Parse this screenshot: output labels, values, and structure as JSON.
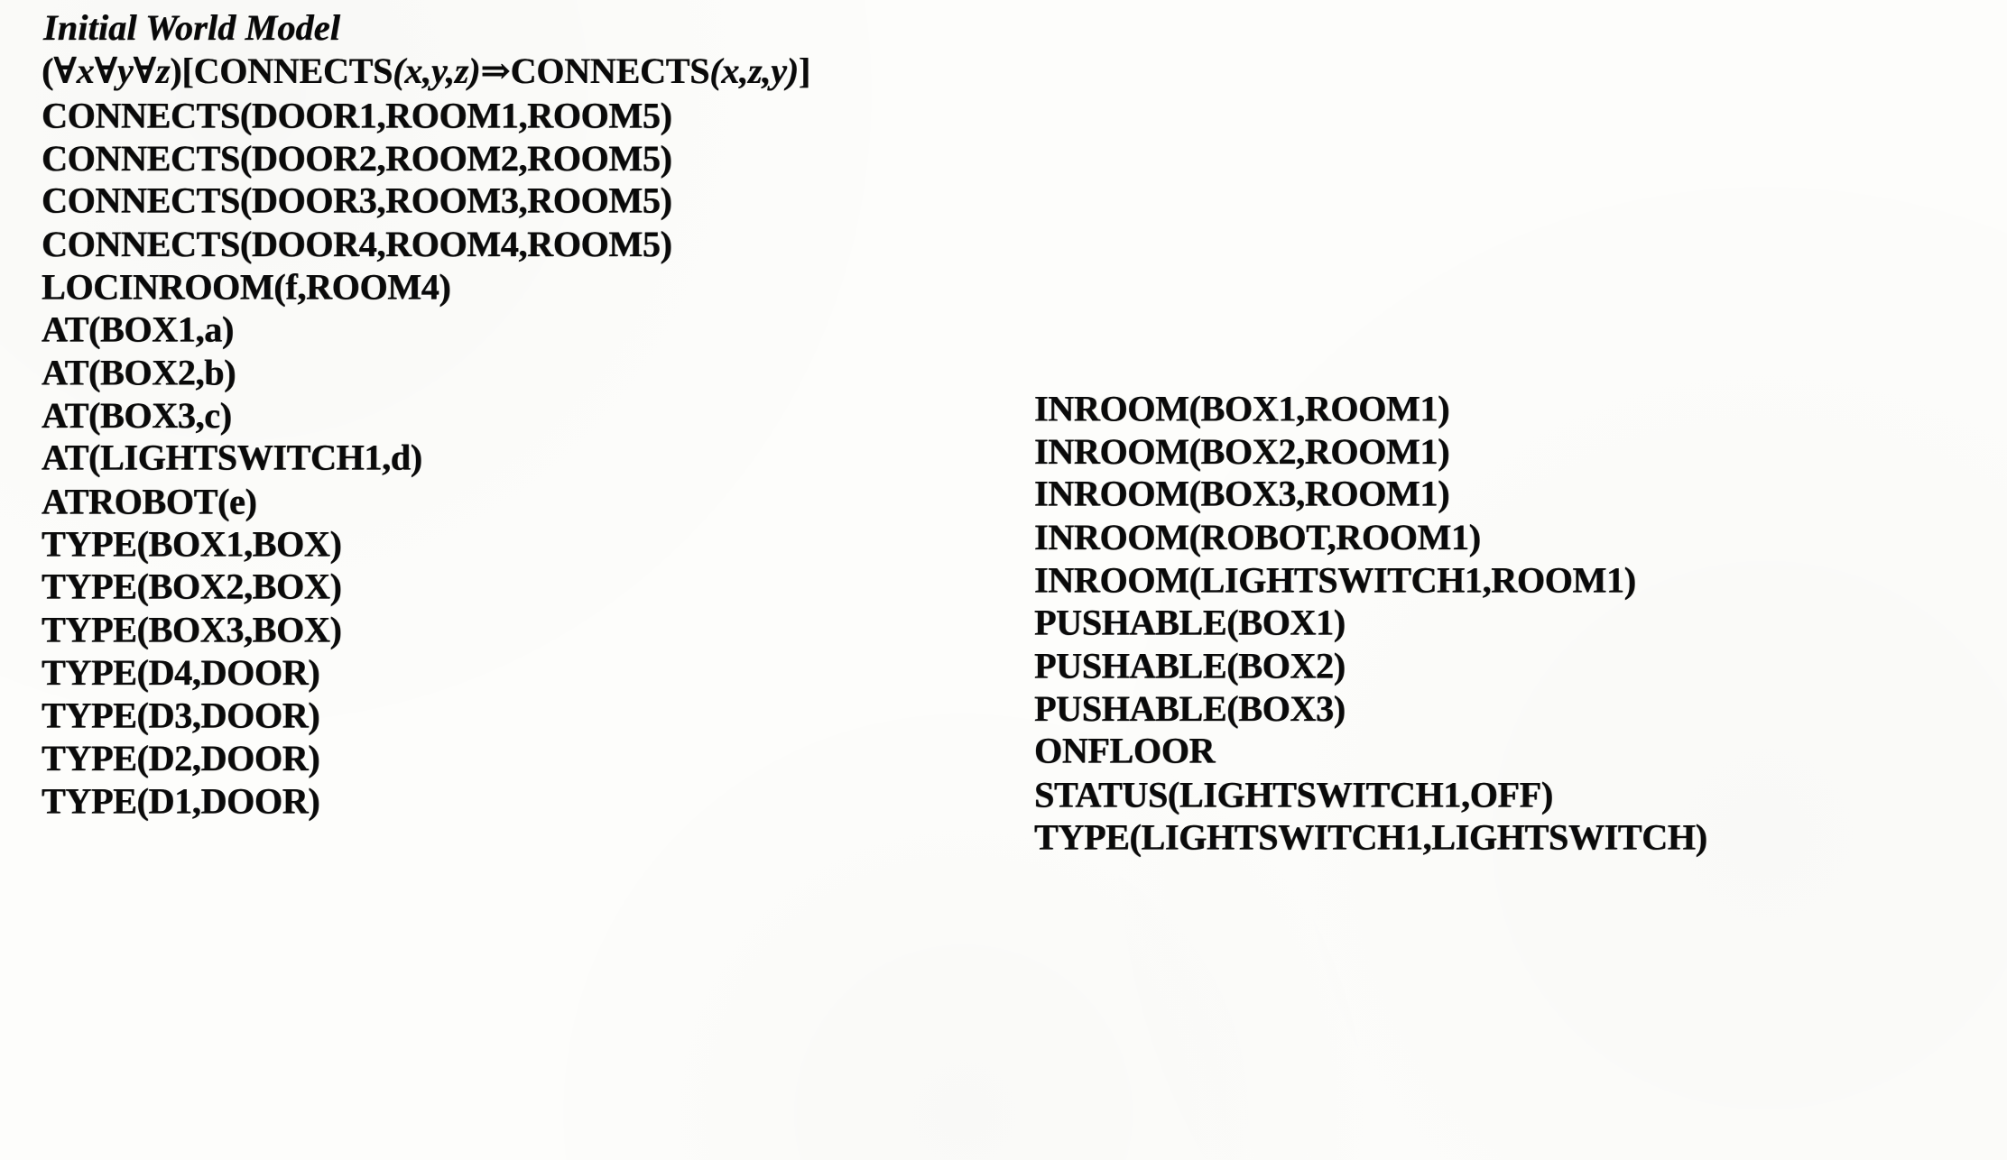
{
  "document": {
    "title": "Initial World Model",
    "axiom": {
      "quantifier_open": "(",
      "quantifiers": "∀x∀y∀z",
      "quantifier_close": ")",
      "bracket_open": "[",
      "antecedent_name": "CONNECTS",
      "antecedent_args": "(x,y,z)",
      "connective": "⇒",
      "consequent_name": "CONNECTS",
      "consequent_args": "(x,z,y)",
      "bracket_close": "]",
      "full_text": "(∀x∀y∀z)[CONNECTS(x,y,z)⇒CONNECTS(x,z,y)]"
    },
    "left_column": [
      "CONNECTS(DOOR1,ROOM1,ROOM5)",
      "CONNECTS(DOOR2,ROOM2,ROOM5)",
      "CONNECTS(DOOR3,ROOM3,ROOM5)",
      "CONNECTS(DOOR4,ROOM4,ROOM5)",
      "LOCINROOM(f,ROOM4)",
      "AT(BOX1,a)",
      "AT(BOX2,b)",
      "AT(BOX3,c)",
      "AT(LIGHTSWITCH1,d)",
      "ATROBOT(e)",
      "TYPE(BOX1,BOX)",
      "TYPE(BOX2,BOX)",
      "TYPE(BOX3,BOX)",
      "TYPE(D4,DOOR)",
      "TYPE(D3,DOOR)",
      "TYPE(D2,DOOR)",
      "TYPE(D1,DOOR)"
    ],
    "right_column": [
      "INROOM(BOX1,ROOM1)",
      "INROOM(BOX2,ROOM1)",
      "INROOM(BOX3,ROOM1)",
      "INROOM(ROBOT,ROOM1)",
      "INROOM(LIGHTSWITCH1,ROOM1)",
      "PUSHABLE(BOX1)",
      "PUSHABLE(BOX2)",
      "PUSHABLE(BOX3)",
      "ONFLOOR",
      "STATUS(LIGHTSWITCH1,OFF)",
      "TYPE(LIGHTSWITCH1,LIGHTSWITCH)"
    ],
    "colors": {
      "ink": "#0a0a0a",
      "paper": "#fdfdfb"
    }
  }
}
